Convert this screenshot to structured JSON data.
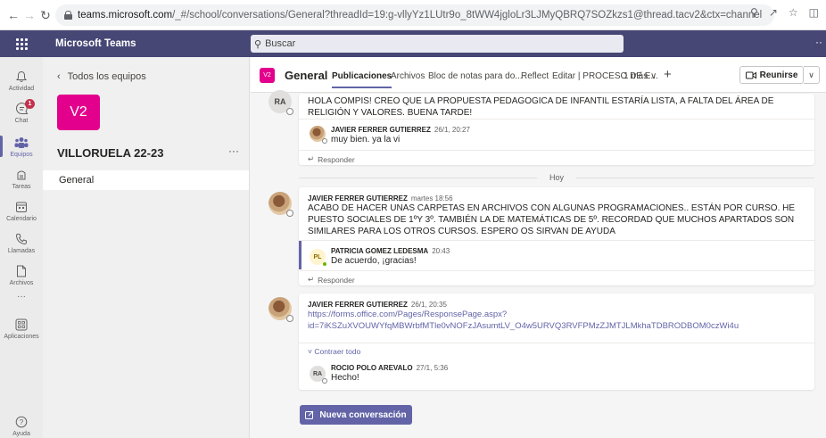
{
  "browser": {
    "url_host": "teams.microsoft.com",
    "url_path": "/_#/school/conversations/General?threadId=19:g-vllyYz1LUtr9o_8tWW4jgloLr3LJMyQBRQ7SOZkzs1@thread.tacv2&ctx=channel"
  },
  "teams_header": {
    "app_name": "Microsoft Teams",
    "search_placeholder": "Buscar",
    "more": "··"
  },
  "rail": {
    "items": [
      {
        "label": "Actividad",
        "icon": "bell-icon"
      },
      {
        "label": "Chat",
        "icon": "chat-icon",
        "badge": "1"
      },
      {
        "label": "Equipos",
        "icon": "teams-icon"
      },
      {
        "label": "Tareas",
        "icon": "assignments-icon"
      },
      {
        "label": "Calendario",
        "icon": "calendar-icon"
      },
      {
        "label": "Llamadas",
        "icon": "phone-icon"
      },
      {
        "label": "Archivos",
        "icon": "file-icon"
      },
      {
        "label": "Aplicaciones",
        "icon": "apps-icon"
      },
      {
        "label": "Ayuda",
        "icon": "help-icon"
      }
    ],
    "more": "···"
  },
  "team_panel": {
    "back_label": "Todos los equipos",
    "team_initials": "V2",
    "team_name": "VILLORUELA 22-23",
    "team_more": "···",
    "channels": [
      "General"
    ]
  },
  "channel_header": {
    "avatar": "V2",
    "title": "General",
    "tabs": [
      "Publicaciones",
      "Archivos",
      "Bloc de notas para do...",
      "Reflect",
      "Editar | PROCESO DE E...",
      "1 más ∨"
    ],
    "add_tab": "+",
    "meet_label": "Reunirse",
    "meet_dropdown": "∨"
  },
  "feed": {
    "post1": {
      "avatar": "RA",
      "text": "HOLA COMPIS! CREO QUE LA PROPUESTA PEDAGOGICA DE INFANTIL ESTARÍA LISTA, A FALTA DEL ÁREA DE RELIGIÓN Y VALORES. BUENA TARDE!",
      "reply": {
        "author": "JAVIER FERRER GUTIERREZ",
        "time": "26/1, 20:27",
        "text": "muy bien. ya la vi"
      },
      "reply_label": "Responder"
    },
    "day_separator": "Hoy",
    "post2": {
      "author": "JAVIER FERRER GUTIERREZ",
      "time": "martes 18:56",
      "text": "ACABO DE HACER UNAS CARPETAS EN ARCHIVOS CON ALGUNAS PROGRAMACIONES.. ESTÁN POR CURSO. HE PUESTO SOCIALES DE 1ºY 3º. TAMBIÉN LA DE MATEMÁTICAS DE 5º. RECORDAD QUE MUCHOS APARTADOS SON SIMILARES PARA LOS OTROS CURSOS. ESPERO OS SIRVAN DE AYUDA",
      "reply": {
        "avatar": "PL",
        "author": "PATRICIA GOMEZ LEDESMA",
        "time": "20:43",
        "text": "De acuerdo, ¡gracias!"
      },
      "reply_label": "Responder"
    },
    "post3": {
      "author": "JAVIER FERRER GUTIERREZ",
      "time": "26/1, 20:35",
      "link_line1": "https://forms.office.com/Pages/ResponsePage.aspx?",
      "link_line2": "id=7iKSZuXVOUWYfqMBWrbfMTle0vNOFzJAsumtLV_O4w5URVQ3RVFPMzZJMTJLMkhaTDBRODBOM0czWi4u",
      "collapse_label": "Contraer todo",
      "reply": {
        "avatar": "RA",
        "author": "ROCIO POLO AREVALO",
        "time": "27/1, 5:36",
        "text": "Hecho!"
      }
    }
  },
  "compose": {
    "new_conversation": "Nueva conversación"
  },
  "colors": {
    "teams_purple": "#464775",
    "accent": "#6264a7",
    "team_tile": "#e3008c",
    "notification": "#c4314b"
  }
}
